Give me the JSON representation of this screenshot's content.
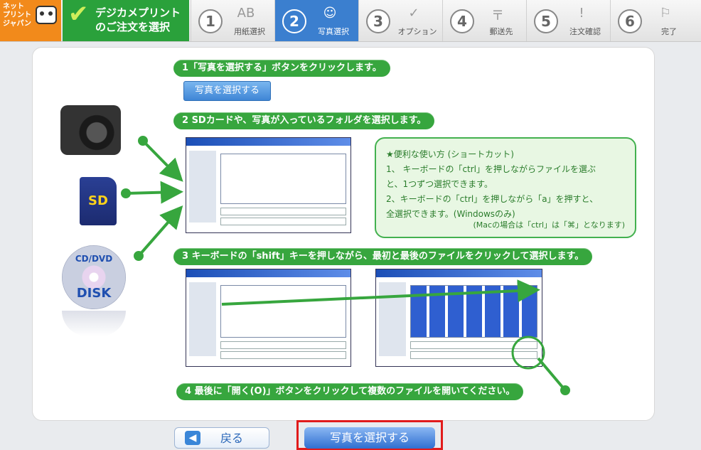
{
  "logo": {
    "line1": "ネット",
    "line2": "プリント",
    "line3": "ジャパン"
  },
  "header": {
    "title_line1": "デジカメプリント",
    "title_line2": "のご注文を選択"
  },
  "steps": [
    {
      "num": "1",
      "label": "用紙選択",
      "icon": "AB"
    },
    {
      "num": "2",
      "label": "写真選択",
      "icon": "☺"
    },
    {
      "num": "3",
      "label": "オプション",
      "icon": "✓"
    },
    {
      "num": "4",
      "label": "郵送先",
      "icon": "〒"
    },
    {
      "num": "5",
      "label": "注文確認",
      "icon": "!"
    },
    {
      "num": "6",
      "label": "完了",
      "icon": "⚐"
    }
  ],
  "instructions": {
    "step1": "1「写真を選択する」ボタンをクリックします。",
    "select_button": "写真を選択する",
    "step2": "2 SDカードや、写真が入っているフォルダを選択します。",
    "step3": "3 キーボードの「shift」キーを押しながら、最初と最後のファイルをクリックして選択します。",
    "step4": "4 最後に「開く(O)」ボタンをクリックして複数のファイルを開いてください。"
  },
  "tips": {
    "title": "★便利な使い方 (ショートカット)",
    "line1": "1、 キーボードの「ctrl」を押しながらファイルを選ぶ",
    "line2": "と、1つずつ選択できます。",
    "line3": "2、キーボードの「ctrl」を押しながら「a」を押すと、",
    "line4": "全選択できます。(Windowsのみ)",
    "note": "(Macの場合は「ctrl」は「⌘」となります)"
  },
  "devices": {
    "sd": "SD",
    "cd_line1": "CD/DVD",
    "cd_line2": "DISK"
  },
  "footer": {
    "back": "戻る",
    "select": "写真を選択する"
  },
  "colors": {
    "green": "#37a63e",
    "blue": "#3b7fcf",
    "red": "#e11b1b",
    "orange": "#f28a1b"
  }
}
